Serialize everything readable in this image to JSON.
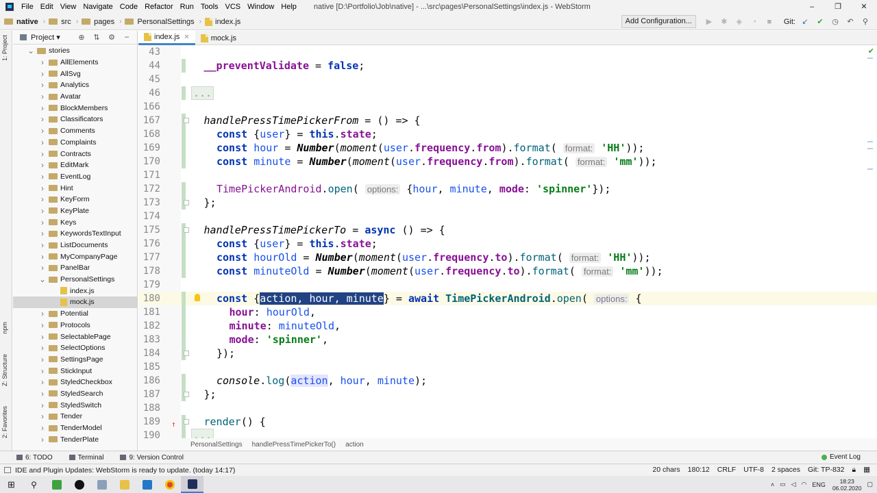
{
  "app": {
    "title": "native [D:\\Portfolio\\Job\\native] - ...\\src\\pages\\PersonalSettings\\index.js - WebStorm",
    "menu": [
      "File",
      "Edit",
      "View",
      "Navigate",
      "Code",
      "Refactor",
      "Run",
      "Tools",
      "VCS",
      "Window",
      "Help"
    ],
    "window_controls": [
      "–",
      "❐",
      "✕"
    ]
  },
  "navbar": {
    "breadcrumb": [
      "native",
      "src",
      "pages",
      "PersonalSettings",
      "index.js"
    ],
    "add_config": "Add Configuration...",
    "git_label": "Git:"
  },
  "project_panel": {
    "title": "Project",
    "tree": [
      {
        "label": "stories",
        "indent": 1,
        "type": "folder",
        "open": true
      },
      {
        "label": "AllElements",
        "indent": 2,
        "type": "folder"
      },
      {
        "label": "AllSvg",
        "indent": 2,
        "type": "folder"
      },
      {
        "label": "Analytics",
        "indent": 2,
        "type": "folder"
      },
      {
        "label": "Avatar",
        "indent": 2,
        "type": "folder"
      },
      {
        "label": "BlockMembers",
        "indent": 2,
        "type": "folder"
      },
      {
        "label": "Classificators",
        "indent": 2,
        "type": "folder"
      },
      {
        "label": "Comments",
        "indent": 2,
        "type": "folder"
      },
      {
        "label": "Complaints",
        "indent": 2,
        "type": "folder"
      },
      {
        "label": "Contracts",
        "indent": 2,
        "type": "folder"
      },
      {
        "label": "EditMark",
        "indent": 2,
        "type": "folder"
      },
      {
        "label": "EventLog",
        "indent": 2,
        "type": "folder"
      },
      {
        "label": "Hint",
        "indent": 2,
        "type": "folder"
      },
      {
        "label": "KeyForm",
        "indent": 2,
        "type": "folder"
      },
      {
        "label": "KeyPlate",
        "indent": 2,
        "type": "folder"
      },
      {
        "label": "Keys",
        "indent": 2,
        "type": "folder"
      },
      {
        "label": "KeywordsTextInput",
        "indent": 2,
        "type": "folder"
      },
      {
        "label": "ListDocuments",
        "indent": 2,
        "type": "folder"
      },
      {
        "label": "MyCompanyPage",
        "indent": 2,
        "type": "folder"
      },
      {
        "label": "PanelBar",
        "indent": 2,
        "type": "folder"
      },
      {
        "label": "PersonalSettings",
        "indent": 2,
        "type": "folder",
        "open": true
      },
      {
        "label": "index.js",
        "indent": 3,
        "type": "file"
      },
      {
        "label": "mock.js",
        "indent": 3,
        "type": "file",
        "selected": true
      },
      {
        "label": "Potential",
        "indent": 2,
        "type": "folder"
      },
      {
        "label": "Protocols",
        "indent": 2,
        "type": "folder"
      },
      {
        "label": "SelectablePage",
        "indent": 2,
        "type": "folder"
      },
      {
        "label": "SelectOptions",
        "indent": 2,
        "type": "folder"
      },
      {
        "label": "SettingsPage",
        "indent": 2,
        "type": "folder"
      },
      {
        "label": "StickInput",
        "indent": 2,
        "type": "folder"
      },
      {
        "label": "StyledCheckbox",
        "indent": 2,
        "type": "folder"
      },
      {
        "label": "StyledSearch",
        "indent": 2,
        "type": "folder"
      },
      {
        "label": "StyledSwitch",
        "indent": 2,
        "type": "folder"
      },
      {
        "label": "Tender",
        "indent": 2,
        "type": "folder"
      },
      {
        "label": "TenderModel",
        "indent": 2,
        "type": "folder"
      },
      {
        "label": "TenderPlate",
        "indent": 2,
        "type": "folder"
      }
    ]
  },
  "left_strip": {
    "project": "1: Project",
    "npm": "npm",
    "structure": "Z: Structure",
    "favorites": "2: Favorites"
  },
  "tabs": [
    {
      "label": "index.js",
      "active": true
    },
    {
      "label": "mock.js",
      "active": false
    }
  ],
  "editor": {
    "lines": [
      {
        "n": "43",
        "html": ""
      },
      {
        "n": "44",
        "html": "<span class='fld'>__preventValidate</span> = <span class='kw'>false</span>;",
        "indent": 1
      },
      {
        "n": "45",
        "html": ""
      },
      {
        "n": "46",
        "html": "<span class='dots'>...</span>",
        "indent": 0
      },
      {
        "n": "166",
        "html": ""
      },
      {
        "n": "167",
        "html": "<span class='fnd'>handlePressTimePickerFrom</span> = () => {",
        "indent": 1,
        "fold": true
      },
      {
        "n": "168",
        "html": "<span class='kw'>const</span> {<span class='var'>user</span>} = <span class='kw'>this</span>.<span class='fld'>state</span>;",
        "indent": 2
      },
      {
        "n": "169",
        "html": "<span class='kw'>const</span> <span class='var'>hour</span> = <span class='cls'>Number</span>(<span class='fnd'>moment</span>(<span class='var'>user</span>.<span class='fld'>frequency</span>.<span class='fld'>from</span>).<span class='fn'>format</span>( <span class='hint'>format:</span> <span class='str'>'HH'</span>));",
        "indent": 2
      },
      {
        "n": "170",
        "html": "<span class='kw'>const</span> <span class='var'>minute</span> = <span class='cls'>Number</span>(<span class='fnd'>moment</span>(<span class='var'>user</span>.<span class='fld'>frequency</span>.<span class='fld'>from</span>).<span class='fn'>format</span>( <span class='hint'>format:</span> <span class='str'>'mm'</span>));",
        "indent": 2
      },
      {
        "n": "171",
        "html": ""
      },
      {
        "n": "172",
        "html": "<span class='fld' style='color:#871094;font-weight:normal'>TimePickerAndroid</span>.<span class='fn'>open</span>( <span class='hint'>options:</span> {<span class='var'>hour</span>, <span class='var'>minute</span>, <span class='fld'>mode</span>: <span class='str'>'spinner'</span>});",
        "indent": 2
      },
      {
        "n": "173",
        "html": "};",
        "indent": 1,
        "fold": true
      },
      {
        "n": "174",
        "html": ""
      },
      {
        "n": "175",
        "html": "<span class='fnd'>handlePressTimePickerTo</span> = <span class='kw'>async</span> () => {",
        "indent": 1,
        "fold": true
      },
      {
        "n": "176",
        "html": "<span class='kw'>const</span> {<span class='var'>user</span>} = <span class='kw'>this</span>.<span class='fld'>state</span>;",
        "indent": 2
      },
      {
        "n": "177",
        "html": "<span class='kw'>const</span> <span class='var'>hourOld</span> = <span class='cls'>Number</span>(<span class='fnd'>moment</span>(<span class='var'>user</span>.<span class='fld'>frequency</span>.<span class='fld'>to</span>).<span class='fn'>format</span>( <span class='hint'>format:</span> <span class='str'>'HH'</span>));",
        "indent": 2
      },
      {
        "n": "178",
        "html": "<span class='kw'>const</span> <span class='var'>minuteOld</span> = <span class='cls'>Number</span>(<span class='fnd'>moment</span>(<span class='var'>user</span>.<span class='fld'>frequency</span>.<span class='fld'>to</span>).<span class='fn'>format</span>( <span class='hint'>format:</span> <span class='str'>'mm'</span>));",
        "indent": 2
      },
      {
        "n": "179",
        "html": ""
      },
      {
        "n": "180",
        "html": "<span class='kw'>const</span> {<span class='selx'>action, hour, minute</span>} = <span class='kw'>await</span> <span class='fn' style='font-weight:bold'>TimePickerAndroid</span>.<span class='fn'>open</span>( <span class='hint'>options:</span> {",
        "indent": 2,
        "current": true,
        "bulb": true
      },
      {
        "n": "181",
        "html": "<span class='fld'>hour</span>: <span class='var'>hourOld</span>,",
        "indent": 3
      },
      {
        "n": "182",
        "html": "<span class='fld'>minute</span>: <span class='var'>minuteOld</span>,",
        "indent": 3
      },
      {
        "n": "183",
        "html": "<span class='fld'>mode</span>: <span class='str'>'spinner'</span>,",
        "indent": 3
      },
      {
        "n": "184",
        "html": "});",
        "indent": 2,
        "fold": true
      },
      {
        "n": "185",
        "html": ""
      },
      {
        "n": "186",
        "html": "<span class='fnd'>console</span>.<span class='fn'>log</span>(<span class='var' style='background:#e4e4ff'>action</span>, <span class='var'>hour</span>, <span class='var'>minute</span>);",
        "indent": 2
      },
      {
        "n": "187",
        "html": "};",
        "indent": 1,
        "fold": true
      },
      {
        "n": "188",
        "html": ""
      },
      {
        "n": "189",
        "html": "<span class='fn'>render</span>() {",
        "indent": 1,
        "fold": true,
        "override": true
      },
      {
        "n": "190",
        "html": "<span class='dots'>...</span>",
        "indent": 0
      }
    ]
  },
  "crumbbar": [
    "PersonalSettings",
    "handlePressTimePickerTo()",
    "action"
  ],
  "bottom_tabs": [
    "6: TODO",
    "Terminal",
    "9: Version Control"
  ],
  "event_log": "Event Log",
  "status": {
    "message": "IDE and Plugin Updates: WebStorm is ready to update. (today 14:17)",
    "items": [
      "20 chars",
      "180:12",
      "CRLF",
      "UTF-8",
      "2 spaces",
      "Git: TP-832"
    ]
  },
  "taskbar": {
    "tray_lang": "ENG",
    "time": "18:23",
    "date": "06.02.2020"
  }
}
